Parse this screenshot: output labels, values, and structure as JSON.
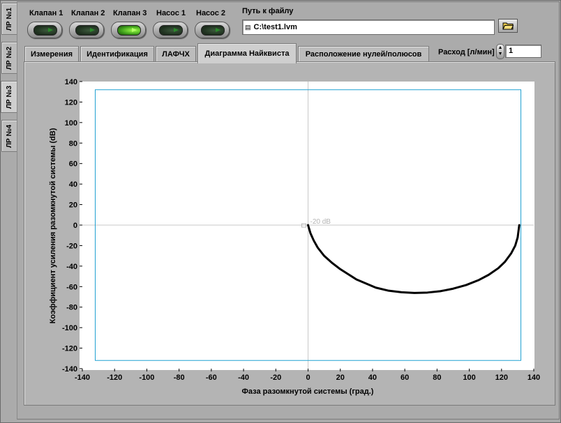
{
  "side_tabs": [
    "ЛР №1",
    "ЛР №2",
    "ЛР №3",
    "ЛР №4"
  ],
  "side_tab_active": 2,
  "leds": [
    {
      "label": "Клапан 1",
      "on": false
    },
    {
      "label": "Клапан 2",
      "on": false
    },
    {
      "label": "Клапан 3",
      "on": true
    },
    {
      "label": "Насос 1",
      "on": false
    },
    {
      "label": "Насос 2",
      "on": false
    }
  ],
  "file_path": {
    "label": "Путь к файлу",
    "value": "C:\\test1.lvm"
  },
  "tabs": [
    {
      "label": "Измерения"
    },
    {
      "label": "Идентификация"
    },
    {
      "label": "ЛАФЧХ"
    },
    {
      "label": "Диаграмма Найквиста"
    },
    {
      "label": "Расположение нулей/полюсов"
    }
  ],
  "tab_active": 3,
  "flow_rate": {
    "label": "Расход [л/мин]",
    "value": "1"
  },
  "chart_data": {
    "type": "line",
    "xlabel": "Фаза разомкнутой системы (град.)",
    "ylabel": "Коэффициент усиления разомкнутой системы (dB)",
    "xlim": [
      -140,
      140
    ],
    "ylim": [
      -140,
      140
    ],
    "xticks": [
      -140,
      -120,
      -100,
      -80,
      -60,
      -40,
      -20,
      0,
      20,
      40,
      60,
      80,
      100,
      120,
      140
    ],
    "yticks": [
      -140,
      -120,
      -100,
      -80,
      -60,
      -40,
      -20,
      0,
      20,
      40,
      60,
      80,
      100,
      120,
      140
    ],
    "annotation": "-20 dB",
    "boundary_box": {
      "x": [
        -132,
        132
      ],
      "y": [
        -132,
        132
      ]
    },
    "series": [
      {
        "color": "#000000",
        "x": [
          0,
          1.5,
          3.5,
          6,
          10,
          15,
          20,
          25,
          30,
          36,
          42,
          50,
          58,
          66,
          74,
          82,
          90,
          98,
          106,
          112,
          118,
          122,
          126,
          128.5,
          130,
          131
        ],
        "y": [
          0,
          -8,
          -15,
          -22,
          -30,
          -37,
          -43,
          -48,
          -53,
          -57,
          -61,
          -64,
          -65.5,
          -66.2,
          -65.8,
          -64.5,
          -62,
          -58.5,
          -53.5,
          -48.5,
          -42,
          -36,
          -27.5,
          -20,
          -12,
          0
        ]
      }
    ]
  }
}
